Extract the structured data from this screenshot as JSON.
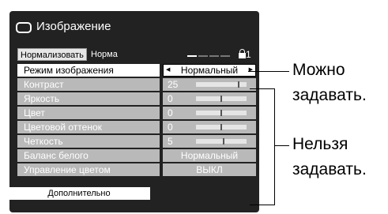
{
  "window": {
    "title": "Изображение",
    "icon": "tv-screen-icon"
  },
  "topbar": {
    "normalize_button": "Нормализовать",
    "normal_label": "Норма",
    "lock_number": "1"
  },
  "rows": [
    {
      "label": "Режим изображения",
      "value": "Нормальный",
      "has_arrows": true,
      "active": true
    },
    {
      "label": "Контраст",
      "value": "25",
      "slider_level": 0.85
    },
    {
      "label": "Яркость",
      "value": "0",
      "slider_level": 0.5
    },
    {
      "label": "Цвет",
      "value": "0",
      "slider_level": 0.5
    },
    {
      "label": "Цветовой оттенок",
      "value": "0",
      "slider_level": 0.5
    },
    {
      "label": "Четкость",
      "value": "5",
      "slider_level": 0.55
    },
    {
      "label": "Баланс белого",
      "value": "Нормальный"
    },
    {
      "label": "Управление цветом",
      "value": "ВЫКЛ"
    }
  ],
  "extra_button": "Дополнительно",
  "callouts": {
    "settable_line1": "Можно",
    "settable_line2": "задавать.",
    "locked_line1": "Нельзя",
    "locked_line2": "задавать."
  },
  "colors": {
    "panel": "#222222",
    "disabled_row": "#b9b9b9",
    "active_row": "#ffffff"
  }
}
